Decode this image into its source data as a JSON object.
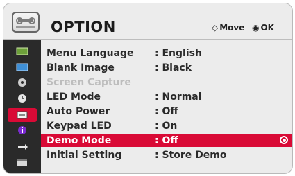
{
  "header": {
    "title": "OPTION",
    "icon": "toolbox-icon",
    "hints": [
      {
        "symbol": "◇",
        "label": "Move",
        "icon": "directional-pad-icon"
      },
      {
        "symbol": "◉",
        "label": "OK",
        "icon": "ok-button-icon"
      }
    ]
  },
  "sidebar": {
    "items": [
      {
        "icon": "picture-icon",
        "active": false
      },
      {
        "icon": "screen-icon",
        "active": false
      },
      {
        "icon": "audio-disc-icon",
        "active": false
      },
      {
        "icon": "clock-icon",
        "active": false
      },
      {
        "icon": "option-toolbox-icon",
        "active": true
      },
      {
        "icon": "info-icon",
        "active": false
      },
      {
        "icon": "input-icon",
        "active": false
      },
      {
        "icon": "media-clapboard-icon",
        "active": false
      }
    ]
  },
  "menu": {
    "items": [
      {
        "label": "Menu Language",
        "value": ": English",
        "state": "normal"
      },
      {
        "label": "Blank Image",
        "value": ": Black",
        "state": "normal"
      },
      {
        "label": "Screen Capture",
        "value": "",
        "state": "disabled"
      },
      {
        "label": "LED Mode",
        "value": ": Normal",
        "state": "normal"
      },
      {
        "label": "Auto Power",
        "value": ": Off",
        "state": "normal"
      },
      {
        "label": "Keypad LED",
        "value": ": On",
        "state": "normal"
      },
      {
        "label": "Demo Mode",
        "value": ": Off",
        "state": "selected"
      },
      {
        "label": "Initial Setting",
        "value": ": Store Demo",
        "state": "normal"
      }
    ]
  },
  "colors": {
    "accent": "#d90a36",
    "sidebar_bg": "#2a2a2a",
    "panel_bg": "#ececec"
  }
}
